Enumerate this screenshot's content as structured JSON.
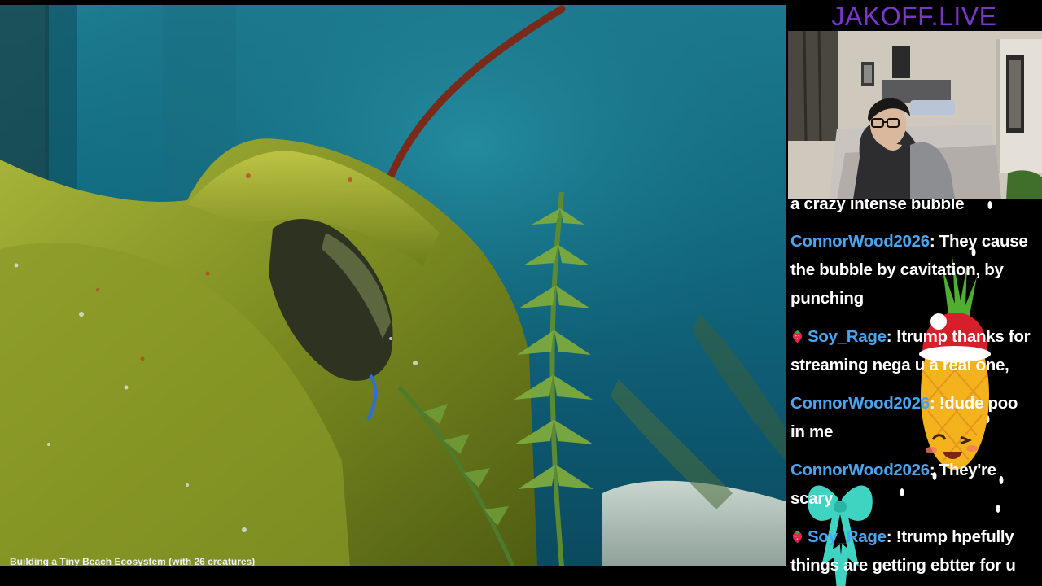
{
  "brand": {
    "title": "JAKOFF.LIVE",
    "color": "#7a35c9"
  },
  "video": {
    "title": "Building a Tiny Beach Ecosystem (with 26 creatures)"
  },
  "chat": {
    "username_color": "#4aa4ee",
    "partial_top": "a crazy intense bubble",
    "messages": [
      {
        "user": "ConnorWood2026",
        "badge": "strawberry-icon",
        "has_badge": false,
        "text": "They cause the bubble by cavitation, by punching"
      },
      {
        "user": "Soy_Rage",
        "badge": "strawberry-icon",
        "has_badge": true,
        "text": "!trump thanks for streaming nega u a real one,"
      },
      {
        "user": "ConnorWood2026",
        "badge": "strawberry-icon",
        "has_badge": false,
        "text": "!dude poo in me"
      },
      {
        "user": "ConnorWood2026",
        "badge": "strawberry-icon",
        "has_badge": false,
        "text": "They're scary"
      },
      {
        "user": "Soy_Rage",
        "badge": "strawberry-icon",
        "has_badge": true,
        "text": "!trump hpefully things are getting ebtter for u"
      }
    ]
  }
}
